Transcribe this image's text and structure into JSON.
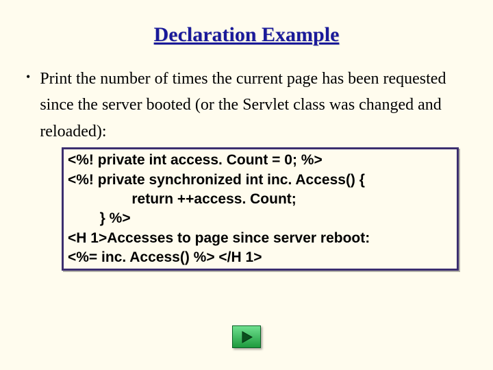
{
  "title": "Declaration Example",
  "bullet": "Print the number of times the current page has been requested since the server booted (or the Servlet class was changed and reloaded):",
  "code": {
    "l1": "<%! private int access. Count = 0; %>",
    "l2": "<%! private synchronized int inc. Access() {",
    "l3": "                return ++access. Count;",
    "l4": "        } %>",
    "l5": "<H 1>Accesses to page since server reboot:",
    "l6": "<%= inc. Access() %> </H 1>"
  }
}
